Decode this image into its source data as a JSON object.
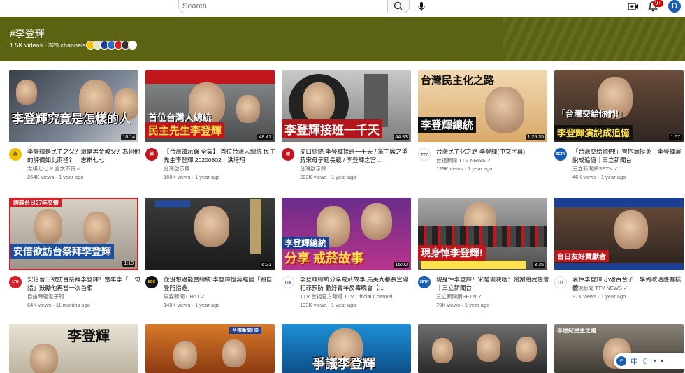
{
  "header": {
    "search_placeholder": "Search",
    "notification_count": "9+",
    "avatar_letter": "D"
  },
  "banner": {
    "hashtag": "#李登輝",
    "stats": "1.5K videos · 329 channels"
  },
  "videos": [
    {
      "title": "李登輝是民主之父？還是黑金教父？為何他的評價如此兩極？｜志祺七七",
      "channel": "志祺七七 X 圖文不符 ✓",
      "meta": "264K views · 1 year ago",
      "duration": "10:14",
      "caption": "李登輝究竟是怎樣的人?",
      "ch": "志"
    },
    {
      "title": "【台灣啟示錄 全集】 首位台灣人總統 民主先生李登輝 20200802｜洪培翔",
      "channel": "台灣啟示錄",
      "meta": "160K views · 1 year ago",
      "duration": "48:41",
      "caption": "民主先生李登輝",
      "top": "首位台灣人總統",
      "ch": "啟"
    },
    {
      "title": "虎口總統 李登輝接班一千天 / 黨主席之爭 蔣宋母子延長戰 / 李登輝之宮...",
      "channel": "台灣啟示錄",
      "meta": "223K views · 1 year ago",
      "duration": "44:33",
      "caption": "李登輝接班一千天",
      "ch": "啟"
    },
    {
      "title": "台灣民主化之路 李登輝(中文字幕)",
      "channel": "台視新聞 TTV NEWS ✓",
      "meta": "129K views · 1 year ago",
      "duration": "1:25:35",
      "caption": "李登輝總統",
      "top": "台灣民主化之路",
      "ch": "TTV"
    },
    {
      "title": "「台灣交給你們!」曾抱病挺英　李登輝演說成追憶｜三立新聞台",
      "channel": "三立新聞網SETN ✓",
      "meta": "46K views · 1 year ago",
      "duration": "1:57",
      "caption": "李登輝演說成追憶",
      "top": "「台灣交給你們!」",
      "ch": "SETN"
    },
    {
      "title": "安倍晉三欲訪台祭拜李登輝！當年李「一句話」鼓勵他再當一次首相",
      "channel": "自由時報電子報",
      "meta": "64K views · 11 months ago",
      "duration": "1:13",
      "caption": "安倍欲訪台祭拜李登輝",
      "top": "跨越台日27年交情",
      "ch": "LTN"
    },
    {
      "title": "從沒想過能當總統!李登輝憶蔣經國「親自登門指邀」",
      "channel": "東森新聞 CH51 ✓",
      "meta": "149K views · 1 year ago",
      "duration": "6:21",
      "caption": "",
      "ch": "EBC"
    },
    {
      "title": "李登輝總統分享戒菸故事 馬英九都長宣導犯罪預防 勸好青年反毒晚會【...",
      "channel": "TTV 台視官方頻道 TTV Official Channel",
      "meta": "193K views · 1 year ago",
      "duration": "16:00",
      "caption": "分享 戒菸故事",
      "top": "李登輝總統",
      "ch": "TTV"
    },
    {
      "title": "現身悼李登輝！宋楚瑜哽咽：謝謝給我機會｜三立新聞台",
      "channel": "三立新聞網SETN ✓",
      "meta": "79K views · 1 year ago",
      "duration": "3:35",
      "caption": "現身悼李登輝!",
      "top": "",
      "ch": "SETN"
    },
    {
      "title": "哀悼李登輝 小池百合子：學到政治應有樣貌",
      "channel": "台視新聞 TTV NEWS ✓",
      "meta": "37K views · 1 year ago",
      "duration": "",
      "caption": "台日友好貢獻者",
      "ch": "TTV"
    },
    {
      "title": "",
      "channel": "",
      "meta": "",
      "duration": "",
      "caption": "李登輝",
      "ch": ""
    },
    {
      "title": "",
      "channel": "",
      "meta": "",
      "duration": "",
      "caption": "",
      "top": "台視新聞HD",
      "ch": ""
    },
    {
      "title": "",
      "channel": "",
      "meta": "",
      "duration": "",
      "caption": "爭議李登輝",
      "ch": ""
    },
    {
      "title": "",
      "channel": "",
      "meta": "",
      "duration": "",
      "caption": "",
      "ch": ""
    },
    {
      "title": "",
      "channel": "",
      "meta": "",
      "duration": "",
      "caption": "",
      "top": "半世紀民主之路",
      "ch": ""
    }
  ],
  "floating_toolbar": {
    "label": "中"
  },
  "colors": {
    "banner_bg": "#5b6312",
    "accent_red": "#cc0000"
  }
}
